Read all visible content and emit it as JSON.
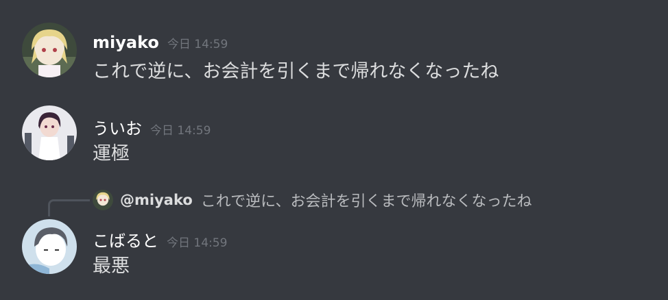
{
  "messages": [
    {
      "username": "miyako",
      "timestamp": "今日 14:59",
      "content": "これで逆に、お会計を引くまで帰れなくなったね",
      "avatar": "miyako-avatar"
    },
    {
      "username": "ういお",
      "timestamp": "今日 14:59",
      "content": "運極",
      "avatar": "uio-avatar"
    },
    {
      "reply": {
        "mention": "@miyako",
        "text": "これで逆に、お会計を引くまで帰れなくなったね"
      },
      "username": "こばると",
      "timestamp": "今日 14:59",
      "content": "最悪",
      "avatar": "kobaruto-avatar"
    }
  ],
  "colors": {
    "background": "#36393f",
    "username": "#ffffff",
    "timestamp": "#72767d",
    "text": "#dcddde",
    "reply_text": "#b9bbbe",
    "reply_line": "#4f545c"
  }
}
